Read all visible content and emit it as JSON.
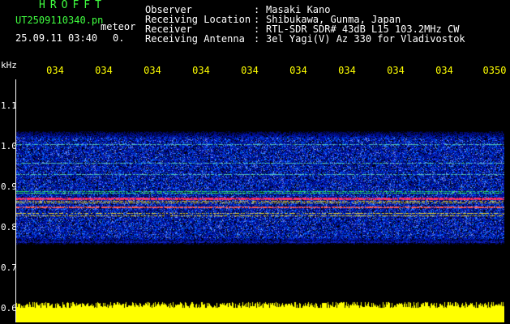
{
  "header": {
    "brand": "HROFFT",
    "filename": "UT2509110340.pn",
    "mode": "meteor",
    "datetime": "25.09.11 03:40",
    "trail_text": "0.",
    "info": [
      {
        "label": "Observer",
        "value": "Masaki Kano"
      },
      {
        "label": "Receiving Location",
        "value": "Shibukawa, Gunma, Japan"
      },
      {
        "label": "Receiver",
        "value": "RTL-SDR SDR# 43dB L15 103.2MHz CW"
      },
      {
        "label": "Receiving Antenna",
        "value": "3el Yagi(V) Az 330 for Vladivostok"
      }
    ],
    "colon": ":"
  },
  "axis": {
    "unit": "kHz",
    "time_ticks": [
      "034",
      "034",
      "034",
      "034",
      "034",
      "034",
      "034",
      "034",
      "034",
      "0350"
    ],
    "freq_ticks": [
      "1.1",
      "1.0",
      "0.9",
      "0.8",
      "0.7",
      "0.6"
    ]
  },
  "colors": {
    "green_text": "#40ff40",
    "white_text": "#ffffff",
    "yellow_text": "#ffff00",
    "carrier_line": "#ff3060",
    "noise_blue": "#0a28c8",
    "baseline_yellow": "#ffff00"
  }
}
